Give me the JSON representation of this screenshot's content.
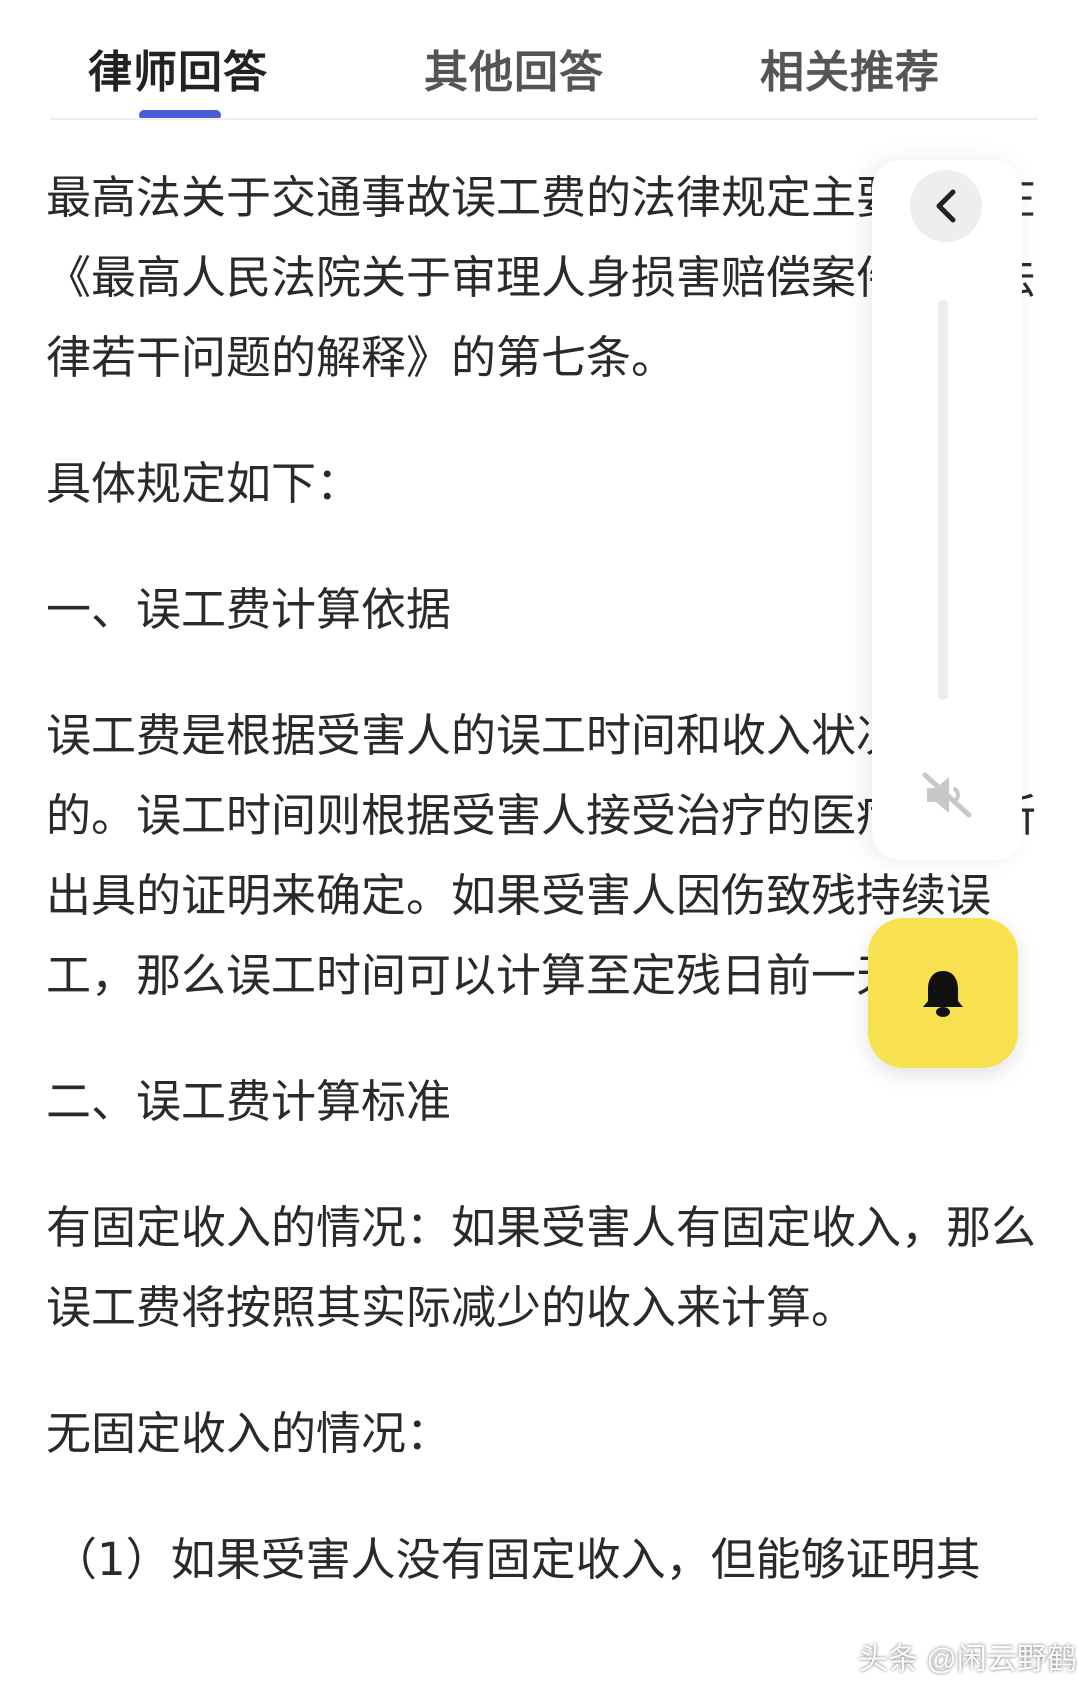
{
  "tabs": [
    {
      "label": "律师回答",
      "active": true
    },
    {
      "label": "其他回答",
      "active": false
    },
    {
      "label": "相关推荐",
      "active": false
    }
  ],
  "accent_color": "#4a5bd4",
  "article": {
    "p1": "最高法关于交通事故误工费的法律规定主要体现在《最高人民法院关于审理人身损害赔偿案件适用法律若干问题的解释》的第七条。",
    "p2": "具体规定如下：",
    "h1": "一、误工费计算依据",
    "p3": "误工费是根据受害人的误工时间和收入状况确定的。误工时间则根据受害人接受治疗的医疗机构所出具的证明来确定。如果受害人因伤致残持续误工，那么误工时间可以计算至定残日前一天。",
    "h2": "二、误工费计算标准",
    "p4": "有固定收入的情况：如果受害人有固定收入，那么误工费将按照其实际减少的收入来计算。",
    "p5": "无固定收入的情况：",
    "p6": "（1）如果受害人没有固定收入，但能够证明其"
  },
  "side_panel": {
    "collapse_icon": "chevron-left-icon",
    "mute_icon": "speaker-muted-icon",
    "bell_icon": "bell-icon",
    "bell_color": "#f7e14f"
  },
  "watermark": "头条 @闲云野鹤"
}
